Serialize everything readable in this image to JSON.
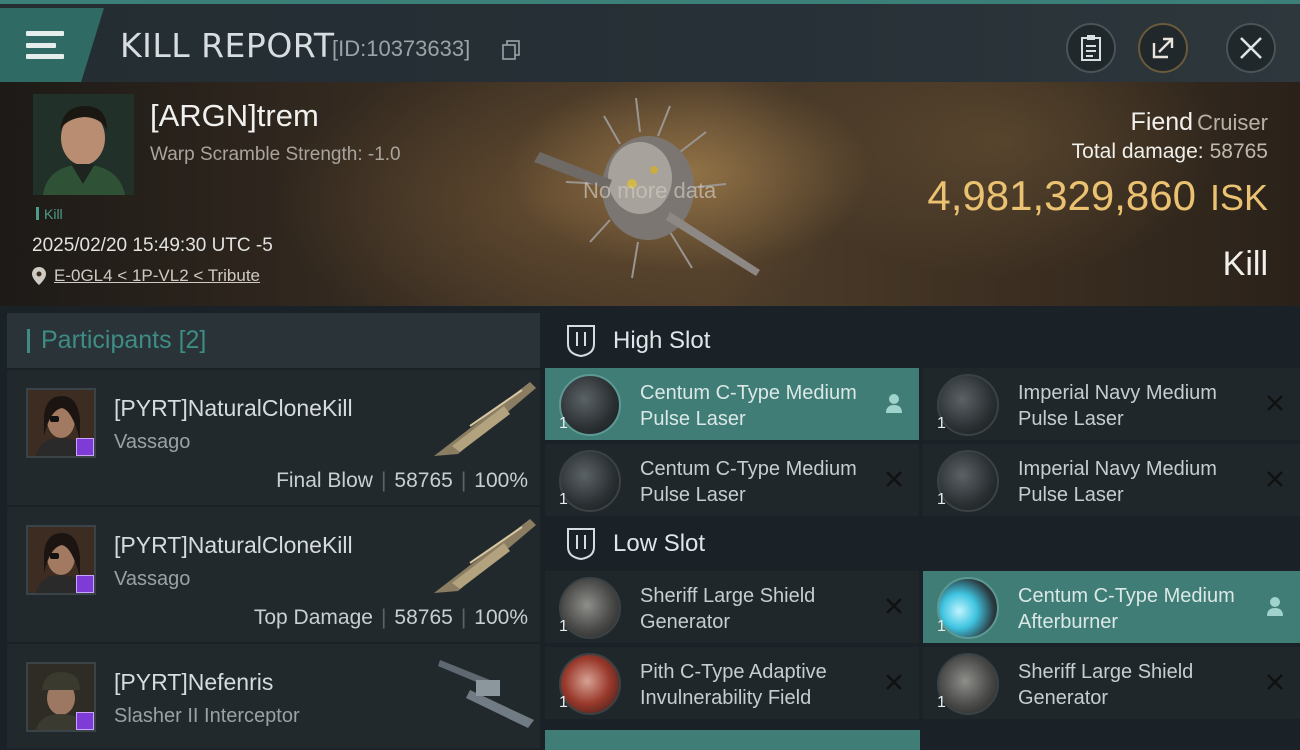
{
  "header": {
    "title": "KILL REPORT",
    "report_id": "[ID:10373633]"
  },
  "victim": {
    "name": "[ARGN]trem",
    "warp_scramble": "Warp Scramble Strength: -1.0",
    "kill_tag": "Kill",
    "datetime": "2025/02/20 15:49:30 UTC -5",
    "location": "E-0GL4 < 1P-VL2 < Tribute",
    "no_data": "No more data"
  },
  "summary": {
    "ship_name": "Fiend",
    "ship_class": "Cruiser",
    "total_damage_label": "Total damage:",
    "total_damage_value": "58765",
    "isk_value": "4,981,329,860",
    "isk_unit": "ISK",
    "result": "Kill"
  },
  "participants": {
    "title": "Participants",
    "count": "[2]",
    "rows": [
      {
        "name": "[PYRT]NaturalCloneKill",
        "ship": "Vassago",
        "role": "Final Blow",
        "damage": "58765",
        "percent": "100%"
      },
      {
        "name": "[PYRT]NaturalCloneKill",
        "ship": "Vassago",
        "role": "Top Damage",
        "damage": "58765",
        "percent": "100%"
      },
      {
        "name": "[PYRT]Nefenris",
        "ship": "Slasher II Interceptor",
        "role": "",
        "damage": "",
        "percent": ""
      }
    ]
  },
  "fitting": {
    "high_slot": {
      "label": "High Slot",
      "modules": [
        {
          "name": "Centum C-Type Medium Pulse Laser",
          "qty": "1",
          "selected": true,
          "action": "user-icon"
        },
        {
          "name": "Imperial Navy Medium Pulse Laser",
          "qty": "1",
          "selected": false,
          "action": "close-icon"
        },
        {
          "name": "Centum C-Type Medium Pulse Laser",
          "qty": "1",
          "selected": false,
          "action": "close-icon"
        },
        {
          "name": "Imperial Navy Medium Pulse Laser",
          "qty": "1",
          "selected": false,
          "action": "close-icon"
        }
      ]
    },
    "low_slot": {
      "label": "Low Slot",
      "modules": [
        {
          "name": "Sheriff Large Shield Generator",
          "qty": "1",
          "selected": false,
          "action": "close-icon"
        },
        {
          "name": "Centum C-Type Medium Afterburner",
          "qty": "1",
          "selected": true,
          "action": "user-icon"
        },
        {
          "name": "Pith C-Type Adaptive Invulnerability Field",
          "qty": "1",
          "selected": false,
          "action": "close-icon"
        },
        {
          "name": "Sheriff Large Shield Generator",
          "qty": "1",
          "selected": false,
          "action": "close-icon"
        }
      ]
    }
  },
  "colors": {
    "accent_teal": "#3f7d76",
    "isk_gold": "#eac271",
    "badge_purple": "#7f3bd6"
  }
}
